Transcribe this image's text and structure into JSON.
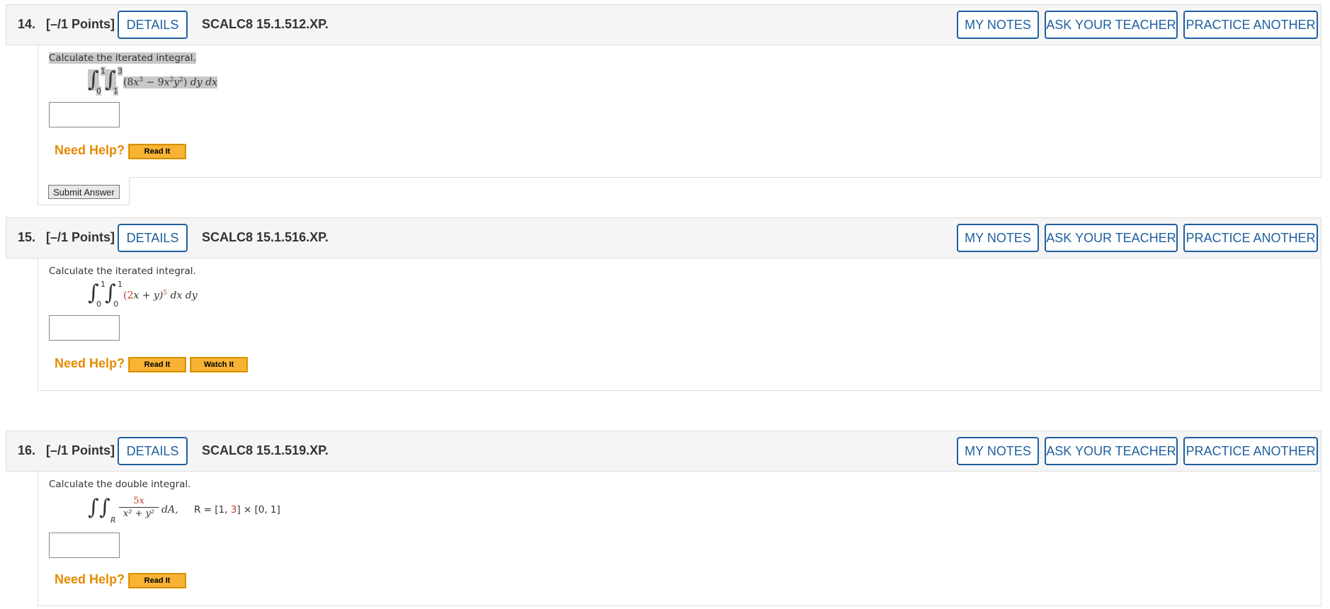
{
  "header_buttons": {
    "details": "DETAILS",
    "my_notes": "MY NOTES",
    "ask_teacher": "ASK YOUR TEACHER",
    "practice_another": "PRACTICE ANOTHER"
  },
  "need_help_label": "Need Help?",
  "read_it_label": "Read It",
  "watch_it_label": "Watch It",
  "submit_label": "Submit Answer",
  "questions": [
    {
      "number": "14.",
      "points": "[–/1 Points]",
      "code": "SCALC8 15.1.512.XP.",
      "prompt": "Calculate the iterated integral.",
      "outer_upper": "1",
      "outer_lower": "0",
      "inner_upper": "3",
      "inner_lower": "1",
      "expr_open": "(8",
      "expr_x": "x",
      "expr_exp3": "3",
      "expr_minus": " − 9",
      "expr_x2": "x",
      "expr_exp2a": "2",
      "expr_y2": "y",
      "expr_exp2b": "2",
      "expr_close": ") ",
      "differentials": "dy dx",
      "answer_value": ""
    },
    {
      "number": "15.",
      "points": "[–/1 Points]",
      "code": "SCALC8 15.1.516.XP.",
      "prompt": "Calculate the iterated integral.",
      "outer_upper": "1",
      "outer_lower": "0",
      "inner_upper": "1",
      "inner_lower": "0",
      "expr_open": "(",
      "expr_coef": "2",
      "expr_body": "x + y)",
      "expr_exp": "5",
      "differentials": " dx dy",
      "answer_value": ""
    },
    {
      "number": "16.",
      "points": "[–/1 Points]",
      "code": "SCALC8 15.1.519.XP.",
      "prompt": "Calculate the double integral.",
      "region_sub": "R",
      "numerator_coef": "5",
      "numerator_var": "x",
      "denominator": "x² + y²",
      "dA": "dA,",
      "region_def_a": "R = [1, ",
      "region_def_b": "3",
      "region_def_c": "] × [0, 1]",
      "answer_value": ""
    }
  ]
}
